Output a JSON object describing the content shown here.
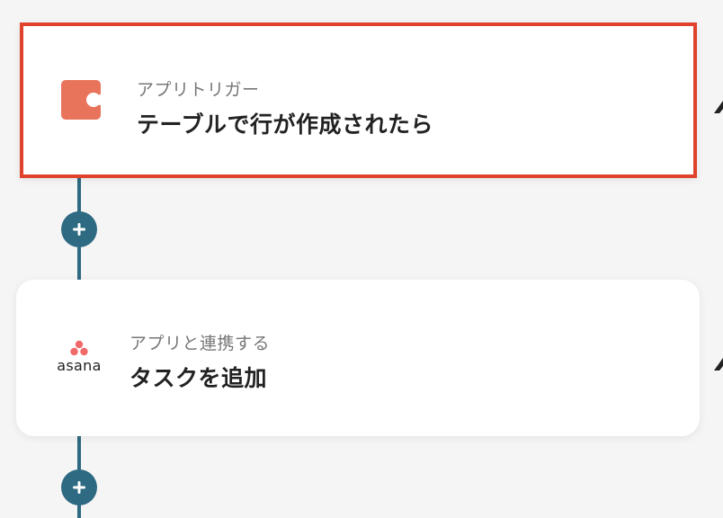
{
  "flow": {
    "trigger": {
      "caption": "アプリトリガー",
      "title": "テーブルで行が作成されたら",
      "icon": "coda-app-icon",
      "highlight_color": "#e0432c",
      "icon_color": "#e8745c"
    },
    "action": {
      "caption": "アプリと連携する",
      "title": "タスクを追加",
      "icon": "asana-logo",
      "logo_word": "asana",
      "icon_color": "#f06a6a"
    },
    "add_step_icon": "plus-icon",
    "connector_color": "#2e6a82"
  }
}
